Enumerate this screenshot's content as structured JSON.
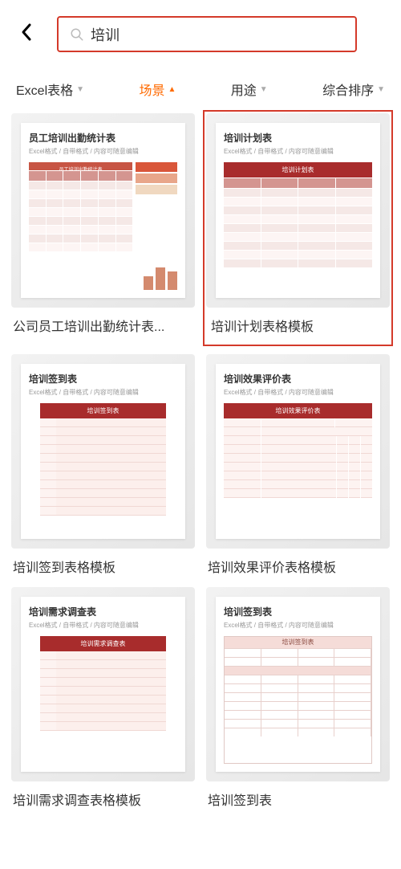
{
  "search": {
    "value": "培训",
    "placeholder": ""
  },
  "filters": [
    {
      "label": "Excel表格",
      "active": false
    },
    {
      "label": "场景",
      "active": true
    },
    {
      "label": "用途",
      "active": false
    },
    {
      "label": "综合排序",
      "active": false
    }
  ],
  "cards": [
    {
      "title": "公司员工培训出勤统计表...",
      "doc_title": "员工培训出勤统计表",
      "doc_subtitle": "Excel格式 / 自带格式 / 内容可随意编辑",
      "mini_header": "员工培训出勤统计表",
      "highlighted": false
    },
    {
      "title": "培训计划表格模板",
      "doc_title": "培训计划表",
      "doc_subtitle": "Excel格式 / 自带格式 / 内容可随意编辑",
      "mini_header": "培训计划表",
      "highlighted": true
    },
    {
      "title": "培训签到表格模板",
      "doc_title": "培训签到表",
      "doc_subtitle": "Excel格式 / 自带格式 / 内容可随意编辑",
      "mini_header": "培训签到表",
      "highlighted": false
    },
    {
      "title": "培训效果评价表格模板",
      "doc_title": "培训效果评价表",
      "doc_subtitle": "Excel格式 / 自带格式 / 内容可随意编辑",
      "mini_header": "培训效果评价表",
      "highlighted": false
    },
    {
      "title": "培训需求调查表格模板",
      "doc_title": "培训需求调查表",
      "doc_subtitle": "Excel格式 / 自带格式 / 内容可随意编辑",
      "mini_header": "培训需求调查表",
      "highlighted": false
    },
    {
      "title": "培训签到表",
      "doc_title": "培训签到表",
      "doc_subtitle": "Excel格式 / 自带格式 / 内容可随意编辑",
      "mini_header": "培训签到表",
      "highlighted": false
    }
  ]
}
